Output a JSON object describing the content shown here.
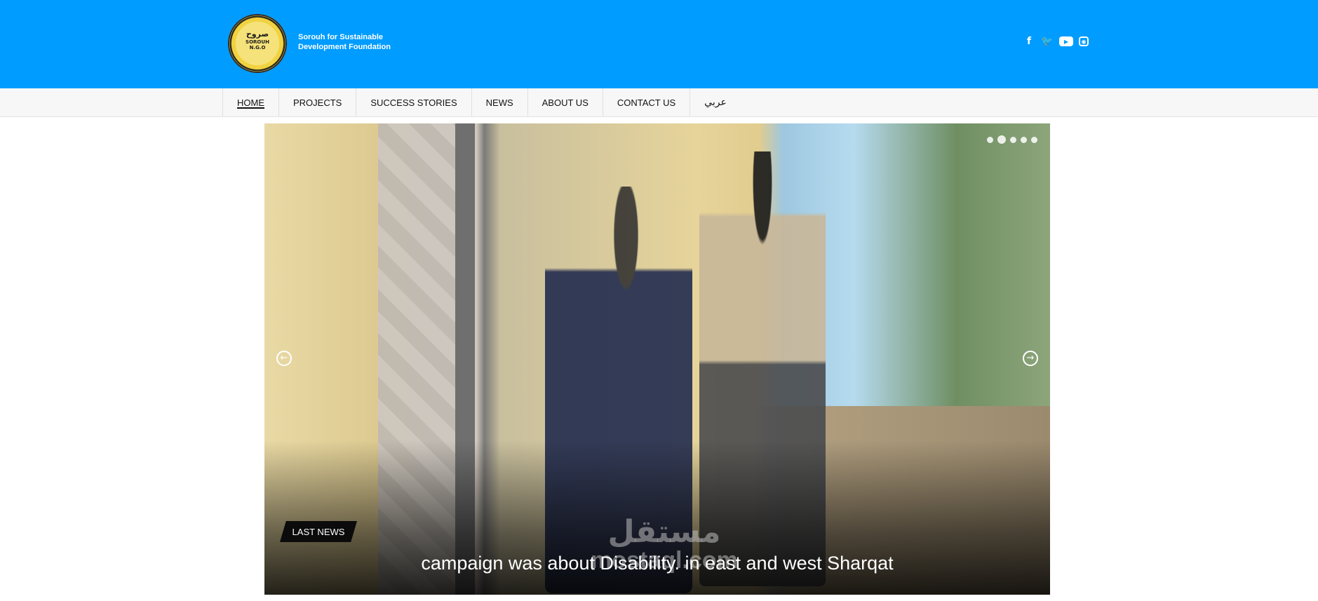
{
  "header": {
    "logo": {
      "arabic_word": "صروح",
      "latin_word": "SOROUH",
      "sub": "N.G.O"
    },
    "org_name": "Sorouh for Sustainable Development Foundation",
    "social": [
      {
        "name": "facebook-icon",
        "glyph": "f"
      },
      {
        "name": "twitter-icon",
        "glyph": "🐦"
      },
      {
        "name": "youtube-icon",
        "glyph": "▶"
      },
      {
        "name": "instagram-icon",
        "glyph": "◉"
      }
    ],
    "colors": {
      "header_bg": "#009cff",
      "text": "#ffffff"
    }
  },
  "nav": {
    "items": [
      "HOME",
      "PROJECTS",
      "SUCCESS STORIES",
      "NEWS",
      "ABOUT US",
      "CONTACT US",
      "عربي"
    ],
    "active_index": 0
  },
  "slider": {
    "tag": "LAST NEWS",
    "headline": "campaign was about Disability. in east and west Sharqat",
    "dots_count": 5,
    "active_dot": 1,
    "prev_glyph": "←",
    "next_glyph": "→",
    "watermark_ar": "مستقل",
    "watermark_en": "mostaql.com"
  }
}
